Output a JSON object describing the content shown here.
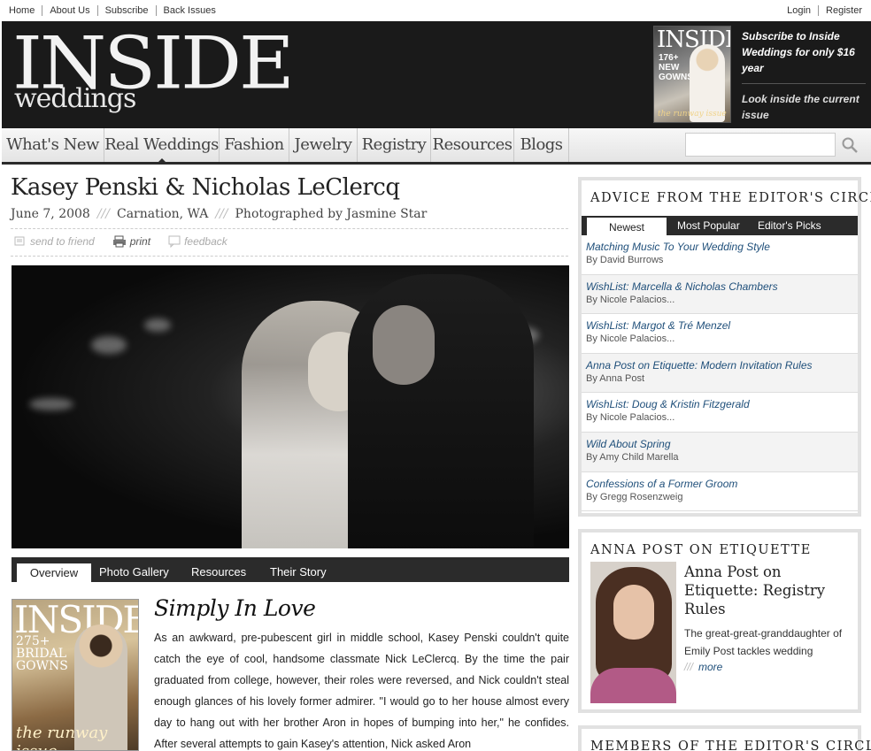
{
  "topbar": {
    "left_links": [
      "Home",
      "About Us",
      "Subscribe",
      "Back Issues"
    ],
    "right_links": [
      "Login",
      "Register"
    ]
  },
  "header": {
    "logo_main": "INSIDE",
    "logo_sub": "weddings",
    "cover": {
      "title": "INSIDE",
      "cover_lines": "176+\nNEW\nGOWNS",
      "tagline": "the runway issue"
    },
    "promo_subscribe": "Subscribe to Inside Weddings for only $16 year",
    "promo_look": "Look inside the current issue"
  },
  "nav": {
    "items": [
      "What's New",
      "Real Weddings",
      "Fashion",
      "Jewelry",
      "Registry",
      "Resources",
      "Blogs"
    ],
    "active": "Real Weddings",
    "search_placeholder": ""
  },
  "article": {
    "title": "Kasey Penski & Nicholas LeClercq",
    "date": "June 7, 2008",
    "location": "Carnation, WA",
    "photographer": "Photographed by Jasmine Star",
    "separator": "///",
    "tools": {
      "send": "send to friend",
      "print": "print",
      "feedback": "feedback"
    },
    "subtabs": [
      "Overview",
      "Photo Gallery",
      "Resources",
      "Their Story"
    ],
    "active_subtab": "Overview",
    "issue_cover": {
      "title": "INSIDE",
      "lines": "275+\nBRIDAL\nGOWNS",
      "tagline": "the runway issue"
    },
    "story_title": "Simply In Love",
    "story_body": "As an awkward, pre-pubescent girl in middle school, Kasey Penski couldn't quite catch the eye of cool, handsome classmate Nick LeClercq. By the time the pair graduated from college, however, their roles were reversed, and Nick couldn't steal enough glances of his lovely former admirer. \"I would go to her house almost every day to hang out with her brother Aron in hopes of bumping into her,\" he confides. After several attempts to gain Kasey's attention, Nick asked Aron"
  },
  "sidebar": {
    "advice": {
      "heading": "ADVICE FROM THE EDITOR'S CIRCLE",
      "tabs": [
        "Newest",
        "Most Popular",
        "Editor's Picks"
      ],
      "active_tab": "Newest",
      "items": [
        {
          "title": "Matching Music To Your Wedding Style",
          "by": "By David Burrows"
        },
        {
          "title": "WishList: Marcella & Nicholas Chambers",
          "by": "By Nicole Palacios..."
        },
        {
          "title": "WishList: Margot & Tré Menzel",
          "by": "By Nicole Palacios..."
        },
        {
          "title": "Anna Post on Etiquette: Modern Invitation Rules",
          "by": "By Anna Post"
        },
        {
          "title": "WishList: Doug & Kristin Fitzgerald",
          "by": "By Nicole Palacios..."
        },
        {
          "title": "Wild About Spring",
          "by": "By Amy Child Marella"
        },
        {
          "title": "Confessions of a Former Groom",
          "by": "By Gregg Rosenzweig"
        }
      ]
    },
    "anna": {
      "heading": "ANNA POST ON ETIQUETTE",
      "title": "Anna Post on Etiquette: Registry Rules",
      "desc": "The great-great-granddaughter of Emily Post tackles wedding",
      "more_sep": "///",
      "more": "more"
    },
    "members": {
      "heading": "MEMBERS OF THE EDITOR'S CIRCLE"
    }
  },
  "colors": {
    "header_bg": "#1a1a1a",
    "link_blue": "#1f4f7a",
    "tab_bar": "#2b2b2b"
  }
}
